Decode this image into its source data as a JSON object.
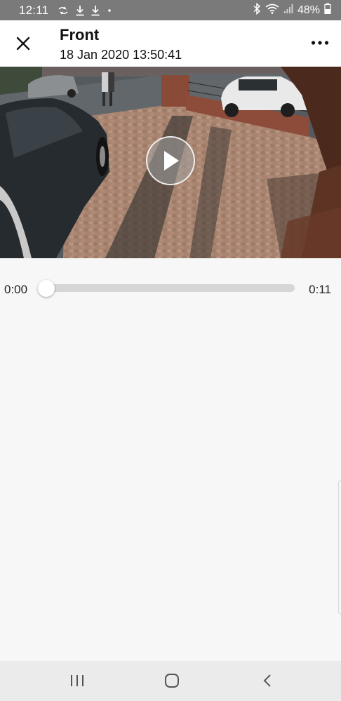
{
  "status_bar": {
    "time": "12:11",
    "battery_percent": "48%",
    "left_icons": [
      "sync-icon",
      "download-icon",
      "download-icon",
      "dot-icon"
    ],
    "right_icons": [
      "bluetooth-icon",
      "wifi-icon",
      "signal-icon",
      "battery-icon"
    ]
  },
  "header": {
    "title": "Front",
    "subtitle": "18 Jan 2020 13:50:41",
    "close_icon": "close-icon",
    "more_icon": "more-icon"
  },
  "video": {
    "play_icon": "play-icon"
  },
  "scrubber": {
    "current_time": "0:00",
    "total_time": "0:11",
    "progress": 0
  },
  "nav_bar": {
    "icons": [
      "recent-apps-icon",
      "home-icon",
      "back-icon"
    ]
  },
  "colors": {
    "status_bar_bg": "#7a7a7a",
    "header_bg": "#ffffff",
    "page_bg": "#f7f7f7",
    "track": "#d6d6d6",
    "nav_bar_bg": "#ebebeb"
  }
}
